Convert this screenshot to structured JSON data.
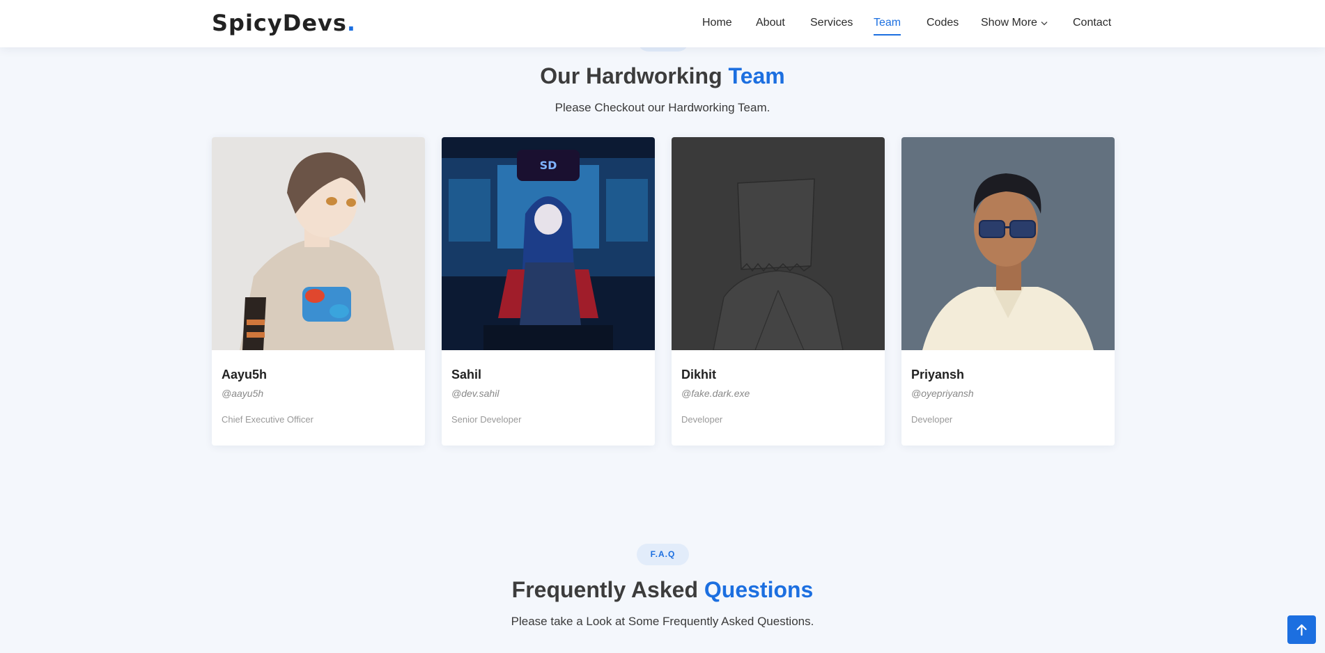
{
  "header": {
    "logo_text": "SpicyDevs",
    "logo_dot": ".",
    "nav": {
      "home": "Home",
      "about": "About",
      "services": "Services",
      "team": "Team",
      "codes": "Codes",
      "show_more": "Show More",
      "contact": "Contact"
    },
    "active_item": "Team"
  },
  "team_section": {
    "title_main": "Our Hardworking",
    "title_accent": "Team",
    "subtitle": "Please Checkout our Hardworking Team.",
    "members": [
      {
        "name": "Aayu5h",
        "handle": "@aayu5h",
        "role": "Chief Executive Officer",
        "photo_icon": "anime-boy-avatar"
      },
      {
        "name": "Sahil",
        "handle": "@dev.sahil",
        "role": "Senior Developer",
        "photo_icon": "hooded-hacker-avatar"
      },
      {
        "name": "Dikhit",
        "handle": "@fake.dark.exe",
        "role": "Developer",
        "photo_icon": "paper-bag-head-avatar"
      },
      {
        "name": "Priyansh",
        "handle": "@oyepriyansh",
        "role": "Developer",
        "photo_icon": "person-with-sunglasses-photo"
      }
    ]
  },
  "faq_section": {
    "badge": "F.A.Q",
    "title_main": "Frequently Asked",
    "title_accent": "Questions",
    "subtitle": "Please take a Look at Some Frequently Asked Questions."
  },
  "colors": {
    "accent": "#1c6fe0",
    "background": "#f4f7fc",
    "badge_bg": "#e2ecfa"
  },
  "scroll_top_icon": "arrow-up-icon"
}
